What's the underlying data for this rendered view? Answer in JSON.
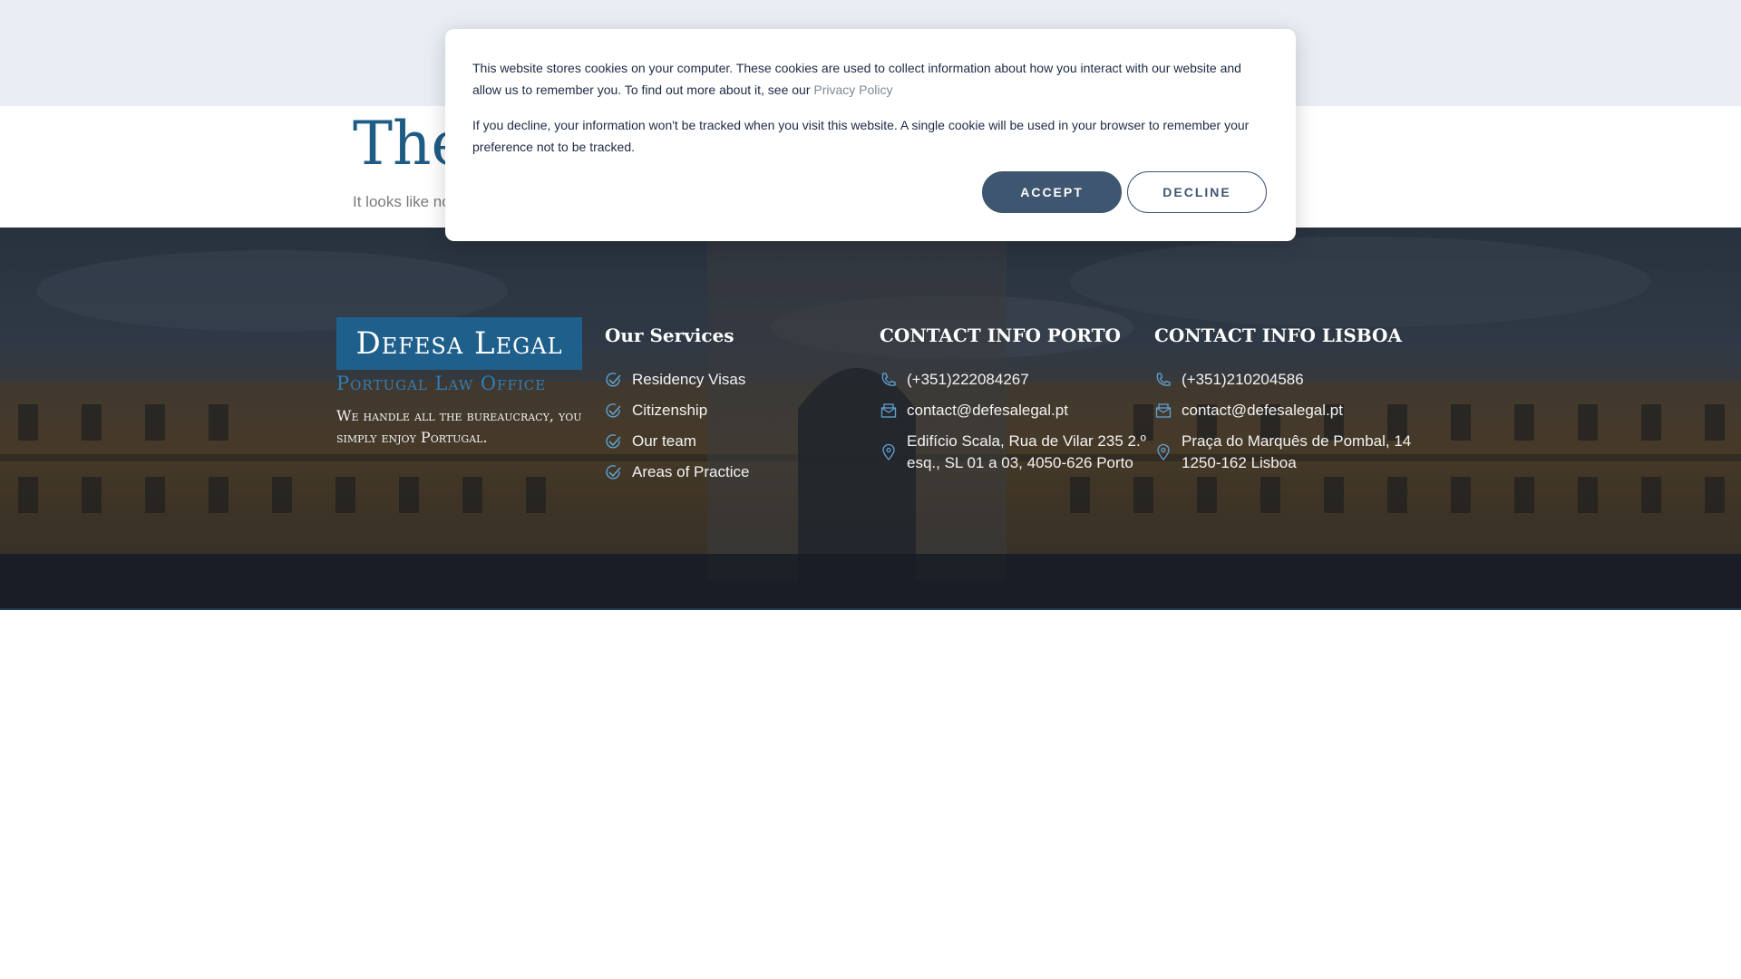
{
  "main": {
    "title_partial": "The",
    "text_partial": "It looks like no"
  },
  "cookie_banner": {
    "paragraph1_text": "This website stores cookies on your computer. These cookies are used to collect information about how you interact with our website and allow us to remember you. To find out more about it, see our",
    "privacy_link": "Privacy Policy",
    "paragraph2_text": "If you decline, your information won't be tracked when you visit this website. A single cookie will be used in your browser to remember your preference not to be tracked.",
    "accept_label": "ACCEPT",
    "decline_label": "DECLINE"
  },
  "footer": {
    "logo_title": "Defesa Legal",
    "logo_subtitle": "Portugal Law Office",
    "tagline": "We handle all the bureaucracy, you simply enjoy Portugal.",
    "services": {
      "title": "Our Services",
      "items": [
        "Residency Visas",
        "Citizenship",
        "Our team",
        "Areas of Practice"
      ]
    },
    "porto": {
      "title": "CONTACT INFO PORTO",
      "phone": "(+351)222084267",
      "email": "contact@defesalegal.pt",
      "address_line1": "Edifício Scala, Rua de Vilar 235 2.º",
      "address_line2": "esq., SL 01 a 03, 4050-626 Porto"
    },
    "lisboa": {
      "title": "CONTACT INFO LISBOA",
      "phone": "(+351)210204586",
      "email": "contact@defesalegal.pt",
      "address_line1": "Praça do Marquês de Pombal, 14",
      "address_line2": "1250-162 Lisboa"
    }
  },
  "colors": {
    "accent": "#1f5f8b",
    "button": "#3f5670",
    "header_bg": "#e9eef5"
  },
  "icons": [
    "check-icon",
    "phone-icon",
    "email-icon",
    "location-icon"
  ]
}
